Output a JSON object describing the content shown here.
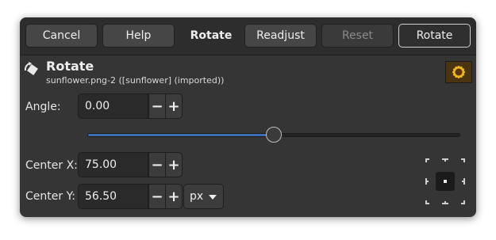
{
  "header": {
    "cancel_label": "Cancel",
    "help_label": "Help",
    "title": "Rotate",
    "readjust_label": "Readjust",
    "reset_label": "Reset",
    "rotate_label": "Rotate"
  },
  "tool": {
    "name": "Rotate",
    "subtitle": "sunflower.png-2 ([sunflower] (imported))",
    "icon": "rotate-tool-icon",
    "thumbnail": "sunflower-thumbnail"
  },
  "angle": {
    "label": "Angle:",
    "value": "0.00",
    "slider_fraction": 0.5
  },
  "center_x": {
    "label": "Center X:",
    "value": "75.00"
  },
  "center_y": {
    "label": "Center Y:",
    "value": "56.50"
  },
  "unit": {
    "selected": "px"
  },
  "spin": {
    "minus": "−",
    "plus": "+"
  },
  "colors": {
    "background": "#353535",
    "header": "#2d2d2d",
    "accent": "#3d6fb0"
  }
}
